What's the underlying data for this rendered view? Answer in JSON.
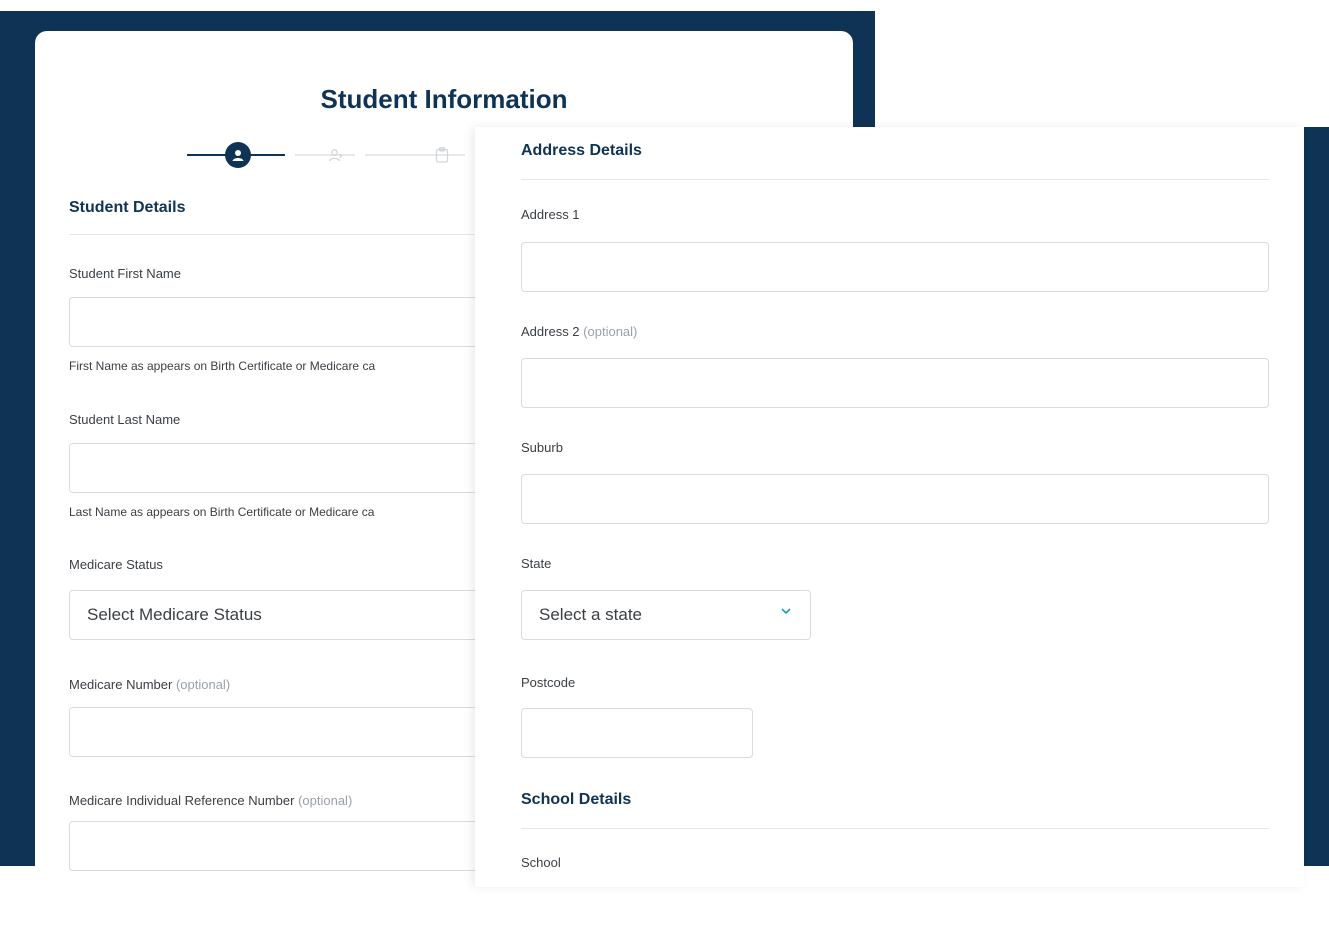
{
  "title": "Student Information",
  "student_details": {
    "heading": "Student Details",
    "first_name_label": "Student First Name",
    "first_name_value": "",
    "first_name_hint": "First Name as appears on Birth Certificate or Medicare ca",
    "last_name_label": "Student Last Name",
    "last_name_value": "",
    "last_name_hint": "Last Name as appears on Birth Certificate or Medicare ca",
    "medicare_status_label": "Medicare Status",
    "medicare_status_placeholder": "Select Medicare Status",
    "medicare_number_label": "Medicare Number",
    "medicare_irn_label": "Medicare Individual Reference Number",
    "optional_text": "(optional)"
  },
  "address_details": {
    "heading": "Address Details",
    "address1_label": "Address 1",
    "address2_label": "Address 2",
    "optional_text": "(optional)",
    "suburb_label": "Suburb",
    "state_label": "State",
    "state_placeholder": "Select a state",
    "postcode_label": "Postcode"
  },
  "school_details": {
    "heading": "School Details",
    "school_label": "School"
  },
  "stepper": {
    "steps": [
      "student-icon",
      "parent-icon",
      "clipboard-icon"
    ],
    "active_step": 1
  },
  "colors": {
    "navy": "#0f3354",
    "accent": "#1b9dbf"
  }
}
